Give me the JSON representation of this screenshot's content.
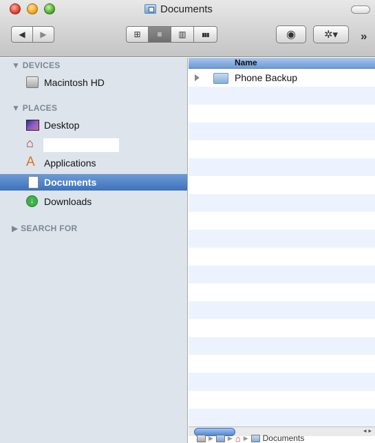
{
  "window": {
    "title": "Documents"
  },
  "toolbar": {
    "back_icon": "◀",
    "forward_icon": "▶",
    "view_icons_glyph": "⊞",
    "view_list_glyph": "≡",
    "view_columns_glyph": "▥",
    "view_coverflow_glyph": "▮▮▮",
    "quicklook_glyph": "◉",
    "action_glyph": "✲▾",
    "overflow_glyph": "»"
  },
  "sidebar": {
    "devices_header": "▼ DEVICES",
    "devices": [
      {
        "label": "Macintosh HD",
        "icon": "hard-drive-icon"
      }
    ],
    "places_header": "▼ PLACES",
    "places": [
      {
        "label": "Desktop",
        "icon": "desktop-icon"
      },
      {
        "label": "",
        "icon": "home-icon"
      },
      {
        "label": "Applications",
        "icon": "applications-icon"
      },
      {
        "label": "Documents",
        "icon": "documents-icon",
        "selected": true
      },
      {
        "label": "Downloads",
        "icon": "downloads-icon"
      }
    ],
    "search_header": "▶ SEARCH FOR"
  },
  "list": {
    "column_name": "Name",
    "rows": [
      {
        "label": "Phone Backup",
        "icon": "folder-icon"
      }
    ]
  },
  "pathbar": {
    "current": "Documents"
  },
  "colors": {
    "selection": "#3c71bd",
    "sidebar_bg": "#dde4eb",
    "stripe": "#edf3fe"
  }
}
